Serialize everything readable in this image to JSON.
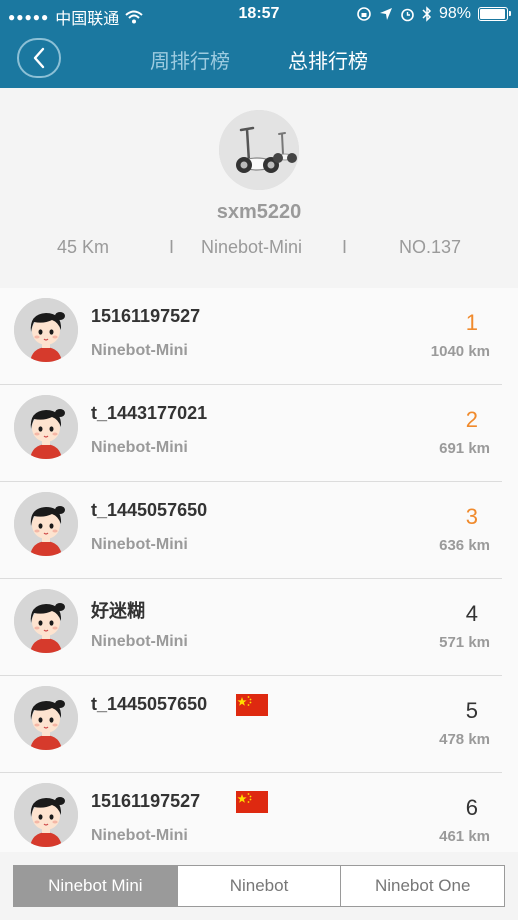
{
  "status_bar": {
    "carrier": "中国联通",
    "time": "18:57",
    "battery": "98%",
    "battery_level": 0.98
  },
  "nav": {
    "tabs": [
      {
        "label": "周排行榜",
        "active": false
      },
      {
        "label": "总排行榜",
        "active": true
      }
    ]
  },
  "profile": {
    "username": "sxm5220",
    "distance": "45 Km",
    "separator": "I",
    "model": "Ninebot-Mini",
    "rank": "NO.137"
  },
  "rankings": [
    {
      "name": "15161197527",
      "model": "Ninebot-Mini",
      "rank": "1",
      "distance": "1040 km",
      "flag": false
    },
    {
      "name": "t_1443177021",
      "model": "Ninebot-Mini",
      "rank": "2",
      "distance": "691 km",
      "flag": false
    },
    {
      "name": "t_1445057650",
      "model": "Ninebot-Mini",
      "rank": "3",
      "distance": "636 km",
      "flag": false
    },
    {
      "name": "好迷糊",
      "model": "Ninebot-Mini",
      "rank": "4",
      "distance": "571 km",
      "flag": false
    },
    {
      "name": "t_1445057650",
      "model": "",
      "rank": "5",
      "distance": "478 km",
      "flag": true
    },
    {
      "name": "15161197527",
      "model": "Ninebot-Mini",
      "rank": "6",
      "distance": "461 km",
      "flag": true
    }
  ],
  "segments": [
    {
      "label": "Ninebot Mini",
      "active": true
    },
    {
      "label": "Ninebot",
      "active": false
    },
    {
      "label": "Ninebot One",
      "active": false
    }
  ],
  "colors": {
    "header": "#1b78a0",
    "top_rank": "#f08a2c"
  }
}
